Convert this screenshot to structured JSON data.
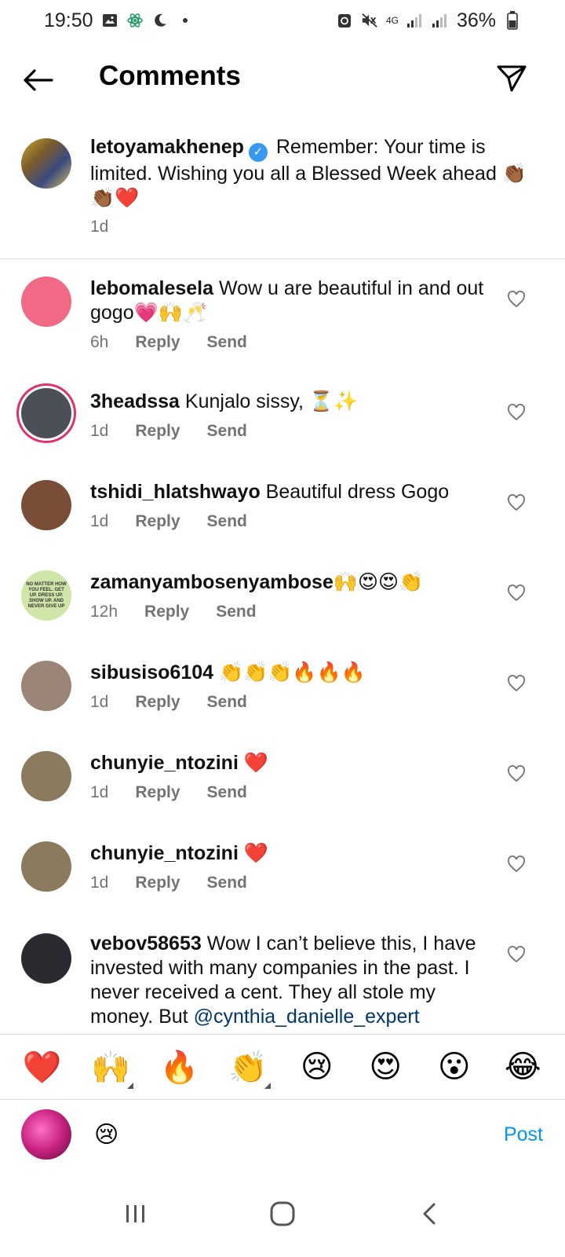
{
  "status_bar": {
    "time": "19:50",
    "network": "4G",
    "battery": "36%"
  },
  "header": {
    "title": "Comments"
  },
  "caption": {
    "username": "letoyamakhenep",
    "text": "Remember: Your time is limited. Wishing you all a Blessed Week ahead",
    "emojis": "👏🏾👏🏾❤️",
    "time": "1d"
  },
  "comments": [
    {
      "username": "lebomalesela",
      "text": "Wow u are beautiful in and out gogo",
      "emojis": "💗🙌🥂",
      "time": "6h",
      "reply": "Reply",
      "send": "Send",
      "avatar_color": "#f06a86"
    },
    {
      "username": "3headssa",
      "text": "Kunjalo sissy,",
      "emojis": "⏳✨",
      "time": "1d",
      "reply": "Reply",
      "send": "Send",
      "avatar_color": "#4b4f57"
    },
    {
      "username": "tshidi_hlatshwayo",
      "text": "Beautiful dress Gogo",
      "emojis": "",
      "time": "1d",
      "reply": "Reply",
      "send": "Send",
      "avatar_color": "#7a4e36"
    },
    {
      "username": "zamanyambosenyambose",
      "text": "",
      "emojis": "🙌😍😍👏",
      "time": "12h",
      "reply": "Reply",
      "send": "Send",
      "avatar_color": "#cfe6a8",
      "avatar_text": "NO MATTER HOW YOU FEEL. GET UP. DRESS UP. SHOW UP. AND NEVER GIVE UP"
    },
    {
      "username": "sibusiso6104",
      "text": "",
      "emojis": "👏👏👏🔥🔥🔥",
      "time": "1d",
      "reply": "Reply",
      "send": "Send",
      "avatar_color": "#9a8576"
    },
    {
      "username": "chunyie_ntozini",
      "text": "",
      "emojis": "❤️",
      "time": "1d",
      "reply": "Reply",
      "send": "Send",
      "avatar_color": "#8b7a5e"
    },
    {
      "username": "chunyie_ntozini",
      "text": "",
      "emojis": "❤️",
      "time": "1d",
      "reply": "Reply",
      "send": "Send",
      "avatar_color": "#8b7a5e"
    },
    {
      "username": "vebov58653",
      "text": "Wow I can’t believe this, I have invested with many companies in the past. I never received a cent. They all stole my money. But",
      "mention": "@cynthia_danielle_expert",
      "emojis": "",
      "time": "",
      "avatar_color": "#2a2a30"
    }
  ],
  "emoji_bar": [
    "❤️",
    "🙌",
    "🔥",
    "👏",
    "😢",
    "😍",
    "😮",
    "😂"
  ],
  "input": {
    "value": "😢",
    "post_label": "Post"
  }
}
